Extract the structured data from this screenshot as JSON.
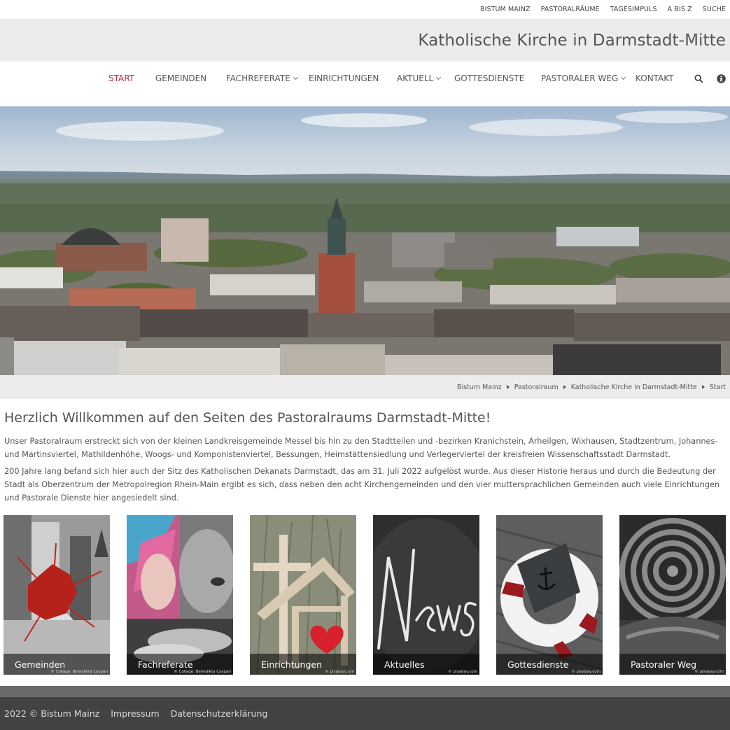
{
  "topbar": {
    "links": [
      "BISTUM MAINZ",
      "PASTORALRÄUME",
      "TAGESIMPULS",
      "A BIS Z",
      "SUCHE"
    ]
  },
  "site_title": "Katholische Kirche in Darmstadt-Mitte",
  "nav": {
    "items": [
      {
        "label": "START",
        "active": true
      },
      {
        "label": "GEMEINDEN"
      },
      {
        "label": "FACHREFERATE",
        "has_dropdown": true
      },
      {
        "label": "EINRICHTUNGEN"
      },
      {
        "label": "AKTUELL",
        "has_dropdown": true
      },
      {
        "label": "GOTTESDIENSTE"
      },
      {
        "label": "PASTORALER WEG",
        "has_dropdown": true
      },
      {
        "label": "KONTAKT"
      }
    ],
    "icons": [
      "search-icon",
      "accessibility-icon"
    ]
  },
  "hero": {
    "icon": "city-skyline-image"
  },
  "breadcrumb": [
    "Bistum Mainz",
    "Pastoralraum",
    "Katholische Kirche in Darmstadt-Mitte",
    "Start"
  ],
  "content": {
    "heading": "Herzlich Willkommen auf den Seiten des Pastoralraums Darmstadt-Mitte!",
    "paragraphs": [
      "Unser Pastoralraum erstreckt sich von der kleinen Landkreisgemeinde Messel bis hin zu den Stadtteilen und -bezirken Kranichstein, Arheilgen, Wixhausen, Stadtzentrum, Johannes- und Martinsviertel, Mathildenhöhe, Woogs- und Komponistenviertel, Bessungen, Heimstättensiedlung und Verlegerviertel der kreisfreien Wissenschaftsstadt Darmstadt.",
      "200 Jahre lang befand sich hier auch der Sitz des Katholischen Dekanats Darmstadt, das am 31. Juli 2022 aufgelöst wurde. Aus dieser Historie heraus und durch die Bedeutung der Stadt als Oberzentrum der Metropolregion Rhein-Main ergibt es sich, dass neben den acht Kirchengemeinden und den vier muttersprachlichen Gemeinden auch viele Einrichtungen und Pastorale Dienste hier angesiedelt sind."
    ]
  },
  "tiles": [
    {
      "label": "Gemeinden",
      "credit": "© Collage: Benedikta Caspari"
    },
    {
      "label": "Fachreferate",
      "credit": "© Collage: Benedikta Caspari"
    },
    {
      "label": "Einrichtungen",
      "credit": "© pixabay.com"
    },
    {
      "label": "Aktuelles",
      "credit": "© pixabay.com"
    },
    {
      "label": "Gottesdienste",
      "credit": "© pixabay.com"
    },
    {
      "label": "Pastoraler Weg",
      "credit": "© pixabay.com"
    }
  ],
  "footer": {
    "copyright": "2022 © Bistum Mainz",
    "links": [
      "Impressum",
      "Datenschutzerklärung"
    ]
  },
  "colors": {
    "accent": "#b0263d",
    "footer_bg": "#424242",
    "footer_strip": "#6b6b6b",
    "bar_bg": "#ececec"
  }
}
